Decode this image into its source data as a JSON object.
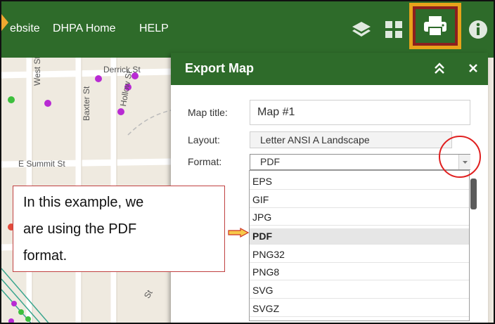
{
  "header": {
    "links": [
      "ebsite",
      "DHPA Home",
      "HELP"
    ]
  },
  "map": {
    "streets": [
      "Derrick St",
      "West St",
      "Baxter St",
      "Hollow St",
      "E Summit St",
      "St",
      "St"
    ]
  },
  "panel": {
    "title": "Export Map",
    "fields": {
      "map_title_label": "Map title:",
      "map_title_value": "Map #1",
      "layout_label": "Layout:",
      "layout_value": "Letter ANSI A Landscape",
      "format_label": "Format:",
      "format_value": "PDF"
    },
    "format_options": [
      "EPS",
      "GIF",
      "JPG",
      "PDF",
      "PNG32",
      "PNG8",
      "SVG",
      "SVGZ"
    ],
    "selected_format": "PDF"
  },
  "callout": {
    "lines": [
      "In this example, we",
      "are using the PDF",
      "format."
    ]
  },
  "icons": [
    "layers-icon",
    "grid-icon",
    "print-icon",
    "info-icon",
    "collapse-icon",
    "close-icon",
    "dropdown-arrow-icon"
  ],
  "colors": {
    "header_green": "#2e6b2a",
    "highlight_orange": "#e8a21a",
    "annotation_red": "#e02020"
  }
}
